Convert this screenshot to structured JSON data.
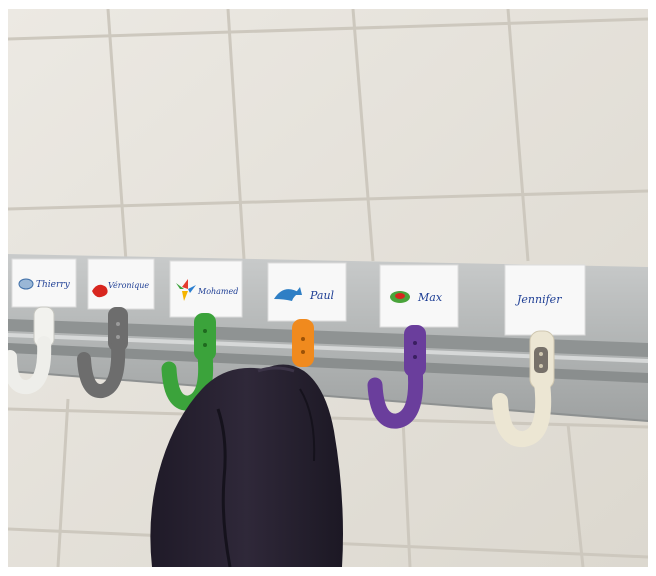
{
  "scene": {
    "description_type": "photo",
    "wall_color": "#e6e2d9",
    "grout_color": "#cfcac0",
    "rail_color": "#b9bcbd"
  },
  "name_labels": [
    {
      "name": "Thierry",
      "icon": "globe-icon",
      "hook_color": "#eeeeea"
    },
    {
      "name": "Véronique",
      "icon": "red-car-icon",
      "hook_color": "#6d6d6d"
    },
    {
      "name": "Mohamed",
      "icon": "pinwheel-icon",
      "hook_color": "#3ba33b"
    },
    {
      "name": "Paul",
      "icon": "dolphin-icon",
      "hook_color": "#f08a1e"
    },
    {
      "name": "Max",
      "icon": "green-car-icon",
      "hook_color": "#6a3e9c"
    },
    {
      "name": "Jennifer",
      "icon": "",
      "hook_color": "#ece6d3"
    }
  ],
  "garment": {
    "icon": "dark-jacket-icon",
    "color": "#2a2433"
  }
}
